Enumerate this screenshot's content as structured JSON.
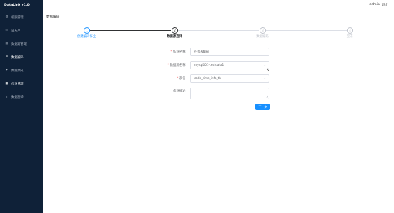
{
  "app": {
    "title": "DataLink v1.0"
  },
  "header": {
    "user": "admin",
    "logout": "退出"
  },
  "sidebar": {
    "items": [
      {
        "label": "权限管理",
        "icon": "settings-icon"
      },
      {
        "label": "日志台",
        "icon": "monitor-icon"
      },
      {
        "label": "数据源管理",
        "icon": "database-icon"
      },
      {
        "label": "数据编码",
        "icon": "code-icon",
        "active": true
      },
      {
        "label": "数据集成",
        "icon": "integration-icon"
      },
      {
        "label": "作业管理",
        "icon": "task-icon",
        "active": true
      },
      {
        "label": "数据查询",
        "icon": "query-icon"
      }
    ]
  },
  "page": {
    "title": "数据编码"
  },
  "steps": [
    {
      "num": "1",
      "label": "创建编码作业",
      "state": "done"
    },
    {
      "num": "2",
      "label": "数据源选择",
      "state": "current"
    },
    {
      "num": "3",
      "label": "数据编码",
      "state": "pending"
    },
    {
      "num": "4",
      "label": "完成",
      "state": "pending"
    }
  ],
  "form": {
    "job_name": {
      "label": "作业名称:",
      "value": "任务表编码"
    },
    "datasource": {
      "label": "数据源名称:",
      "value": "mysql001-testdata1"
    },
    "table": {
      "label": "表名:",
      "value": "code_time_info_tb"
    },
    "description": {
      "label": "作业描述:",
      "value": ""
    }
  },
  "actions": {
    "next": "下一步"
  }
}
